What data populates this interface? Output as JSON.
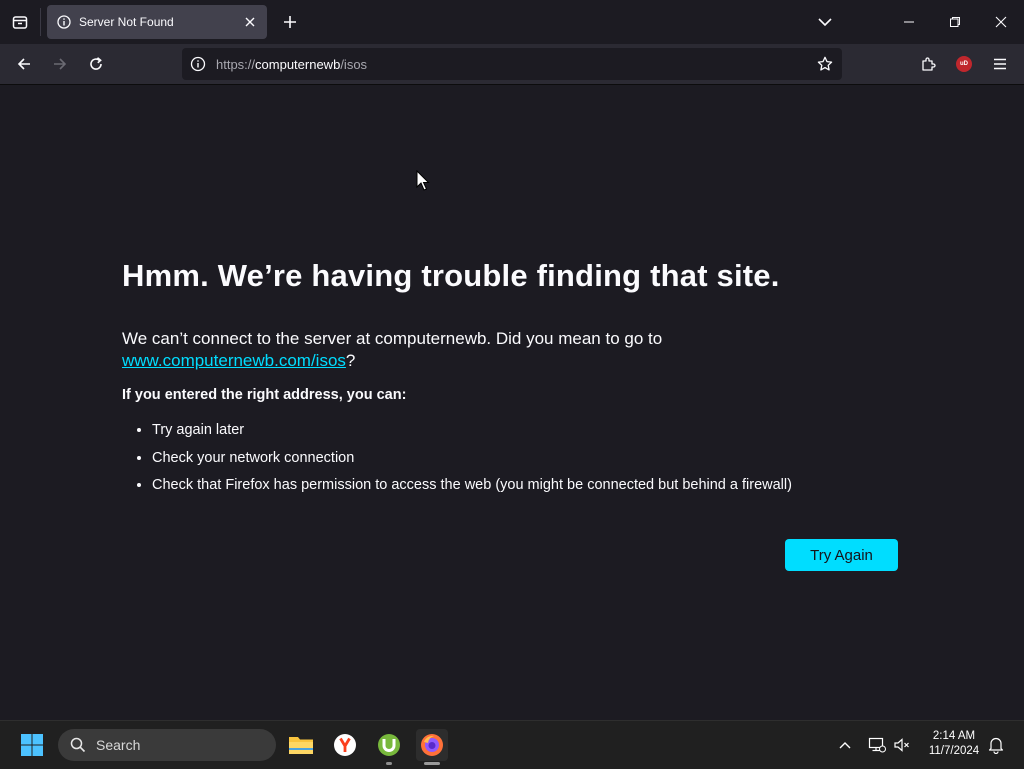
{
  "browser": {
    "tab": {
      "title": "Server Not Found"
    },
    "url": {
      "scheme": "https://",
      "host": "computernewb",
      "path": "/isos"
    },
    "extension_badge": "uD"
  },
  "error_page": {
    "heading": "Hmm. We’re having trouble finding that site.",
    "message_prefix": "We can’t connect to the server at computernewb. Did you mean to go to ",
    "suggested_link": "www.computernewb.com/isos",
    "message_suffix": "?",
    "subheading": "If you entered the right address, you can:",
    "suggestions": [
      "Try again later",
      "Check your network connection",
      "Check that Firefox has permission to access the web (you might be connected but behind a firewall)"
    ],
    "button_label": "Try Again"
  },
  "taskbar": {
    "search_label": "Search",
    "time": "2:14 AM",
    "date": "11/7/2024"
  },
  "colors": {
    "accent": "#00ddff",
    "page_bg": "#1c1b22",
    "toolbar_bg": "#2b2a33",
    "tab_bg": "#42414d",
    "taskbar_bg": "#202020"
  },
  "icons": [
    "tab-list-icon",
    "info-icon",
    "close-icon",
    "plus-icon",
    "chevron-down-icon",
    "minimize-icon",
    "restore-icon",
    "window-close-icon",
    "back-icon",
    "forward-icon",
    "reload-icon",
    "star-icon",
    "extensions-icon",
    "ublock-icon",
    "menu-icon",
    "windows-start-icon",
    "search-icon",
    "file-explorer-icon",
    "yandex-browser-icon",
    "utorrent-icon",
    "firefox-icon",
    "chevron-up-icon",
    "network-icon",
    "volume-muted-icon",
    "notification-bell-icon"
  ]
}
